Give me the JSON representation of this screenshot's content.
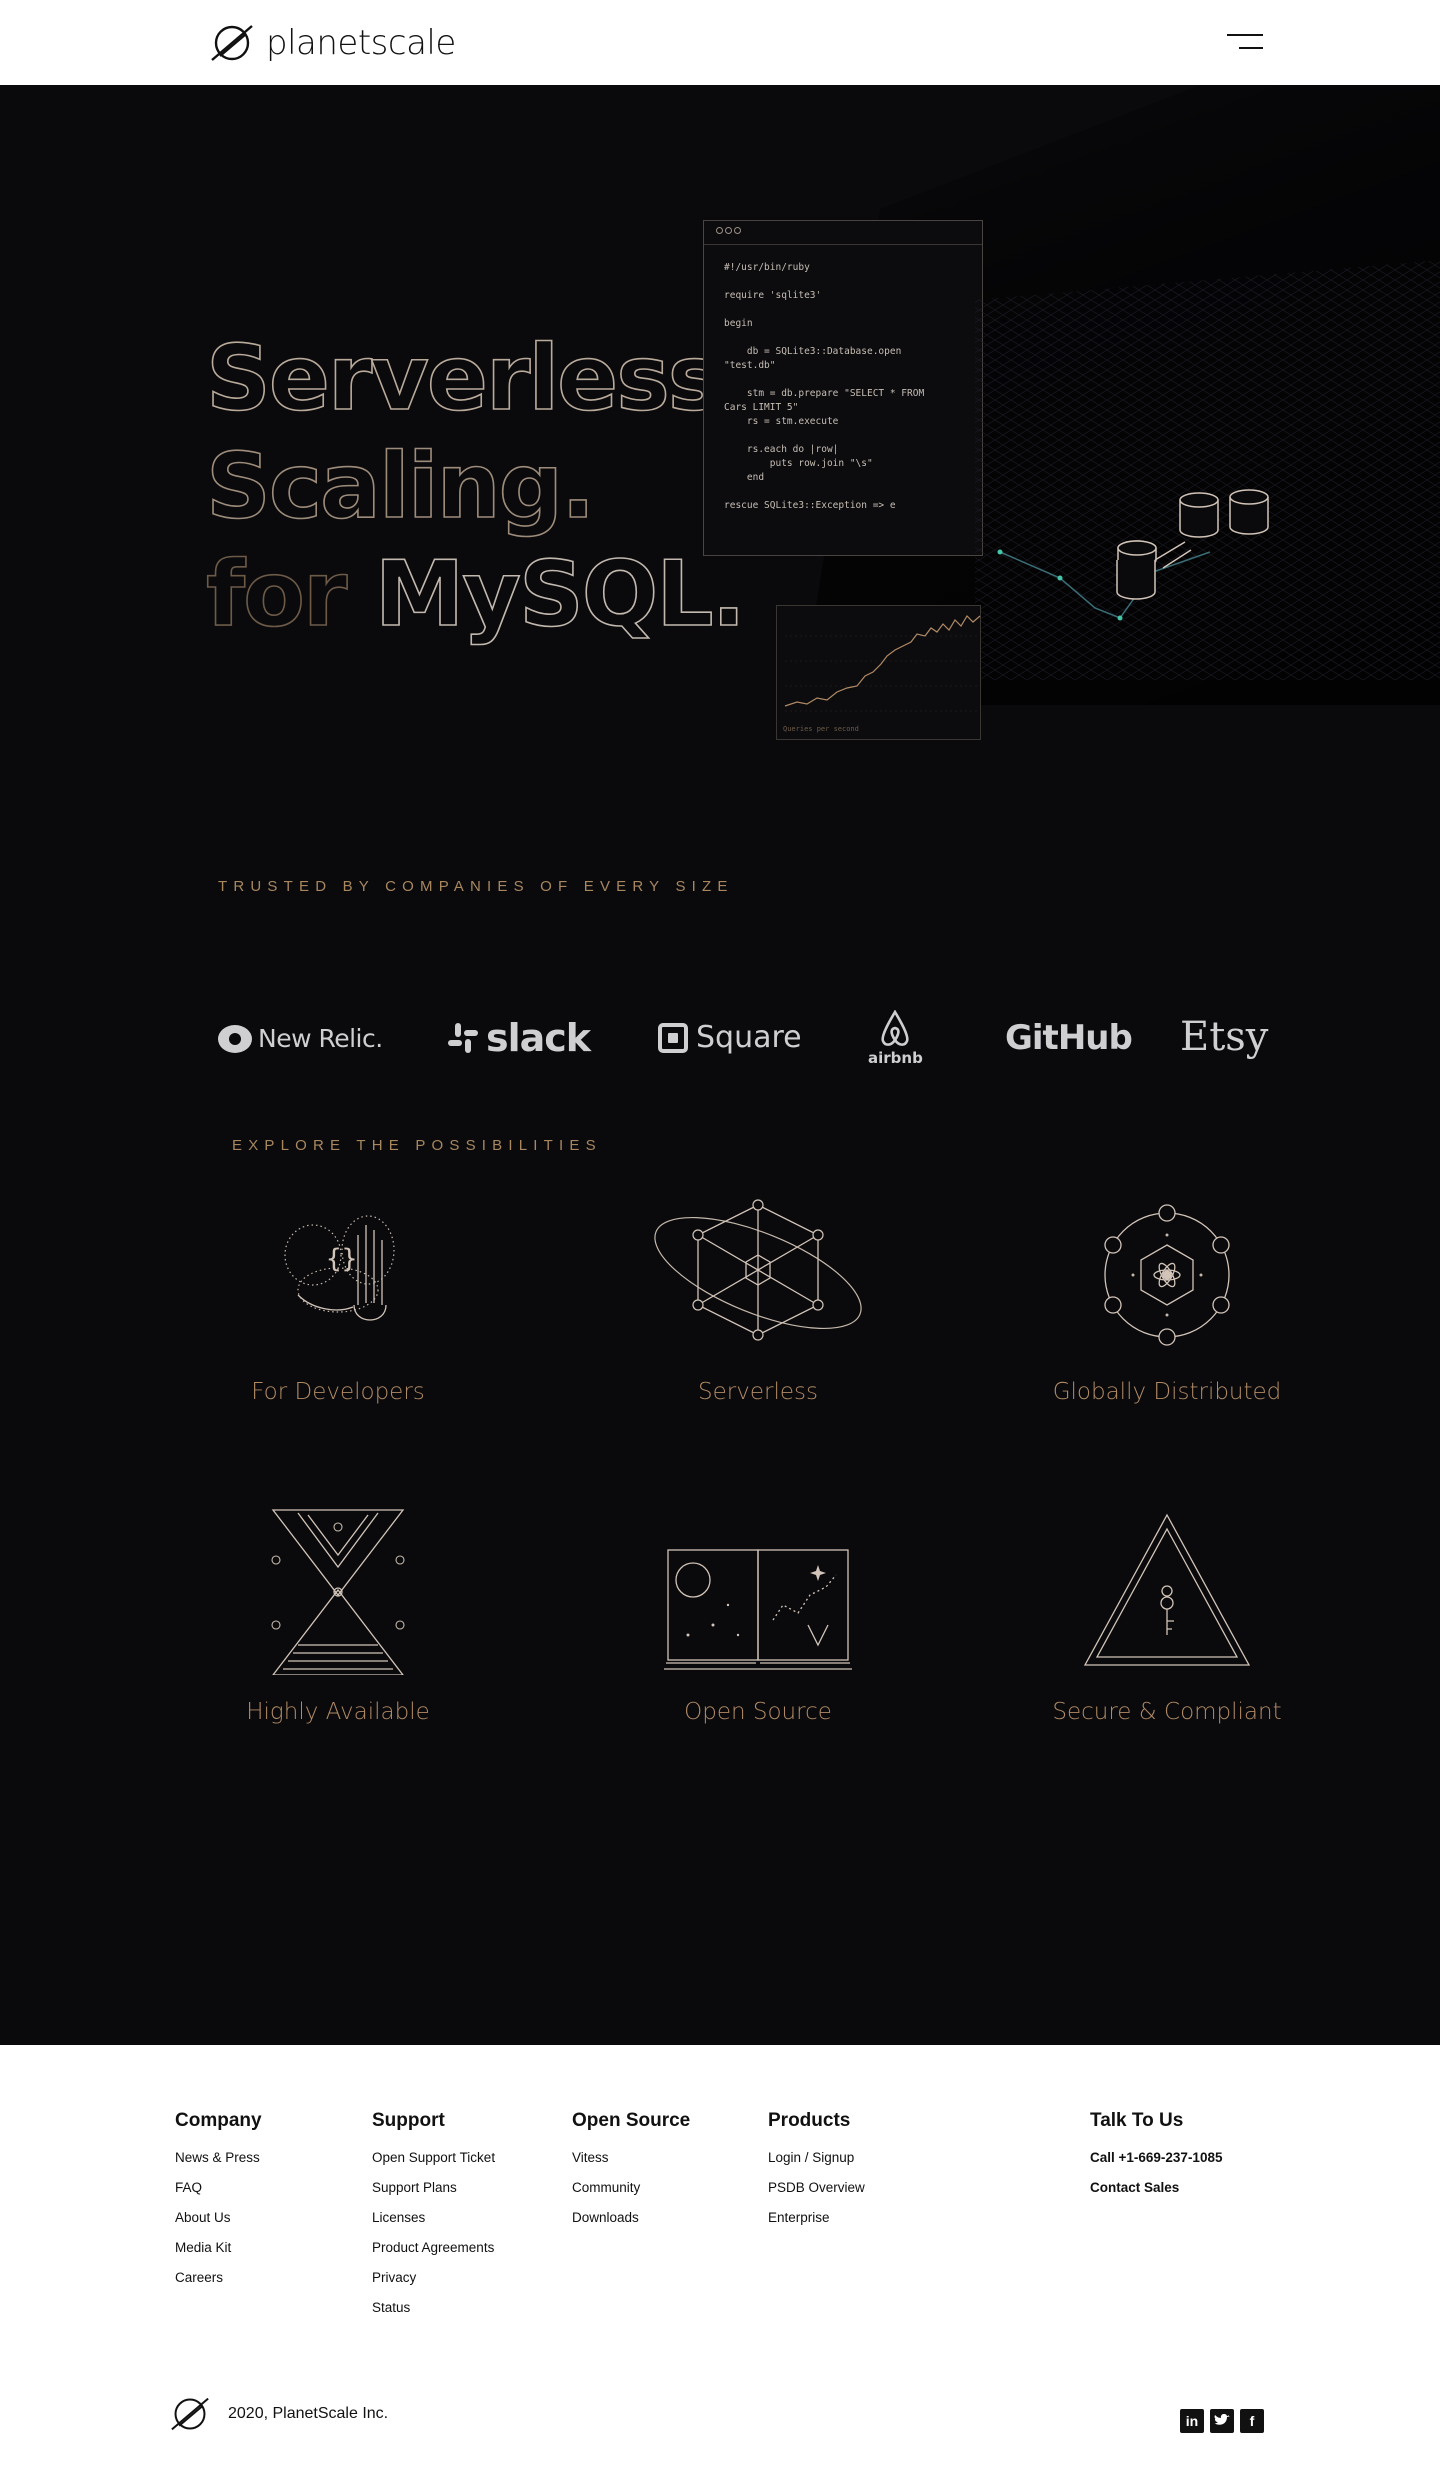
{
  "header": {
    "brand": "planetscale",
    "menu_icon": "hamburger-menu-icon"
  },
  "hero": {
    "line1": "Serverless.",
    "line2": "Scaling.",
    "line3a": "for",
    "line3b": "MySQL.",
    "code_lines": "#!/usr/bin/ruby\n\nrequire 'sqlite3'\n\nbegin\n\n    db = SQLite3::Database.open\n\"test.db\"\n\n    stm = db.prepare \"SELECT * FROM\nCars LIMIT 5\"\n    rs = stm.execute\n\n    rs.each do |row|\n        puts row.join \"\\s\"\n    end\n\nrescue SQLite3::Exception => e",
    "chart_label": "Queries per second"
  },
  "trusted": {
    "title": "TRUSTED BY COMPANIES OF EVERY SIZE",
    "logos": [
      "New Relic.",
      "slack",
      "Square",
      "airbnb",
      "GitHub",
      "Etsy"
    ]
  },
  "explore": {
    "title": "EXPLORE THE POSSIBILITIES",
    "features": [
      {
        "label": "For Developers",
        "icon": "hands-code-icon"
      },
      {
        "label": "Serverless",
        "icon": "orbit-cube-icon"
      },
      {
        "label": "Globally Distributed",
        "icon": "atom-network-icon"
      },
      {
        "label": "Highly Available",
        "icon": "hourglass-icon"
      },
      {
        "label": "Open Source",
        "icon": "open-book-icon"
      },
      {
        "label": "Secure & Compliant",
        "icon": "triangle-key-icon"
      }
    ]
  },
  "footer": {
    "columns": [
      {
        "title": "Company",
        "links": [
          "News & Press",
          "FAQ",
          "About Us",
          "Media Kit",
          "Careers"
        ]
      },
      {
        "title": "Support",
        "links": [
          "Open Support Ticket",
          "Support Plans",
          "Licenses",
          "Product Agreements",
          "Privacy",
          "Status"
        ]
      },
      {
        "title": "Open Source",
        "links": [
          "Vitess",
          "Community",
          "Downloads"
        ]
      },
      {
        "title": "Products",
        "links": [
          "Login / Signup",
          "PSDB Overview",
          "Enterprise"
        ]
      },
      {
        "title": "Talk To Us",
        "links": [
          "Call +1-669-237-1085",
          "Contact Sales"
        ]
      }
    ],
    "copyright": "2020, PlanetScale Inc.",
    "social": [
      "linkedin-icon",
      "twitter-icon",
      "facebook-icon"
    ]
  },
  "colors": {
    "dark_bg": "#0a0a0d",
    "accent_gold": "#a8875f",
    "text_light": "#cfcfd2"
  }
}
